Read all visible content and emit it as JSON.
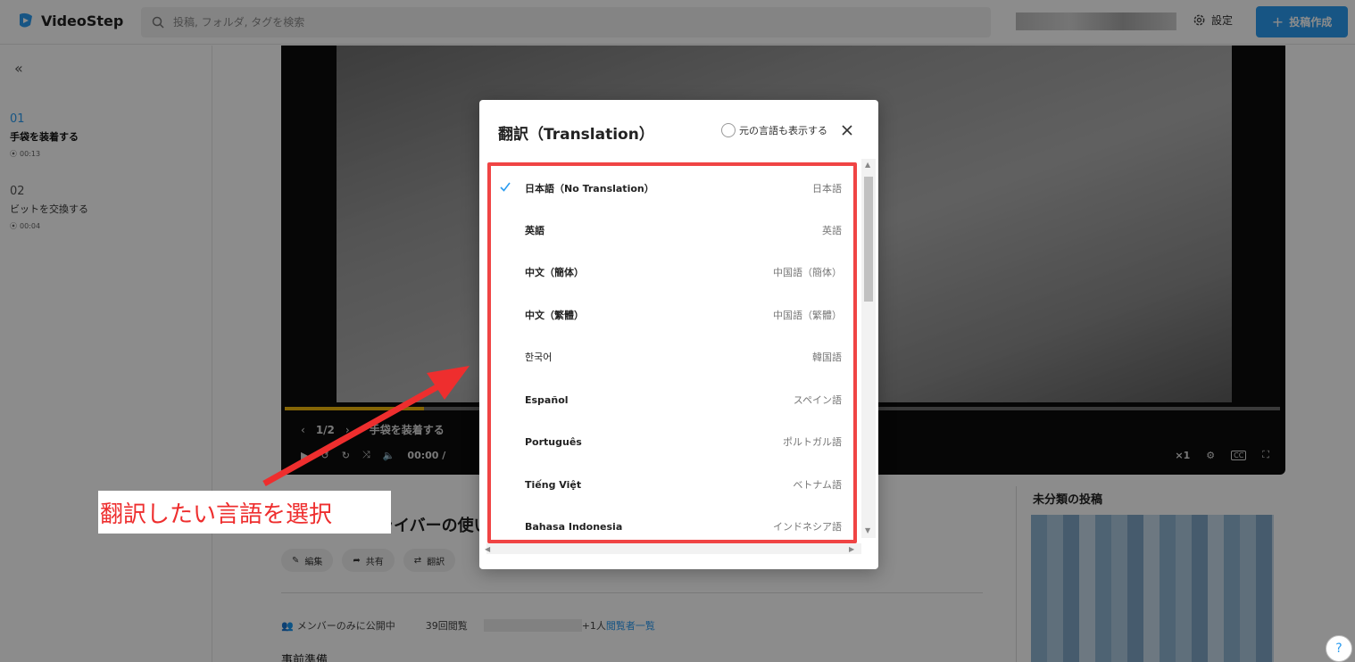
{
  "header": {
    "logo_text": "VideoStep",
    "search_placeholder": "投稿, フォルダ, タグを検索",
    "settings_label": "設定",
    "create_label": "投稿作成"
  },
  "sidebar": {
    "steps": [
      {
        "num": "01",
        "title": "手袋を装着する",
        "time": "00:13"
      },
      {
        "num": "02",
        "title": "ビットを交換する",
        "time": "00:04"
      }
    ]
  },
  "player": {
    "page_indicator": "1/2",
    "step_title": "手袋を装着する",
    "time": "00:00 /",
    "speed": "×1",
    "progress_fraction": 0.14
  },
  "below": {
    "title": "インパクトドライバーの使い",
    "actions": [
      "編集",
      "共有",
      "翻訳"
    ],
    "visibility": "メンバーのみに公開中",
    "views": "39回閲覧",
    "viewers_more": "+1人",
    "viewers_link": "閲覧者一覧",
    "prep": "事前準備"
  },
  "right_panel": {
    "title": "未分類の投稿"
  },
  "modal": {
    "title": "翻訳（Translation）",
    "show_original": "元の言語も表示する",
    "languages": [
      {
        "name": "日本語（No Translation）",
        "native": "日本語",
        "selected": true
      },
      {
        "name": "英語",
        "native": "英語",
        "selected": false
      },
      {
        "name": "中文（簡体）",
        "native": "中国語（簡体）",
        "selected": false
      },
      {
        "name": "中文（繁體）",
        "native": "中国語（繁體）",
        "selected": false
      },
      {
        "name": "한국어",
        "native": "韓国語",
        "selected": false
      },
      {
        "name": "Español",
        "native": "スペイン語",
        "selected": false
      },
      {
        "name": "Português",
        "native": "ポルトガル語",
        "selected": false
      },
      {
        "name": "Tiếng Việt",
        "native": "ベトナム語",
        "selected": false
      },
      {
        "name": "Bahasa Indonesia",
        "native": "インドネシア語",
        "selected": false
      }
    ]
  },
  "annotation": {
    "text": "翻訳したい言語を選択"
  },
  "help_label": "?",
  "colors": {
    "accent": "#2b9cf0",
    "highlight": "#f04444",
    "progress": "#f0b90b"
  }
}
